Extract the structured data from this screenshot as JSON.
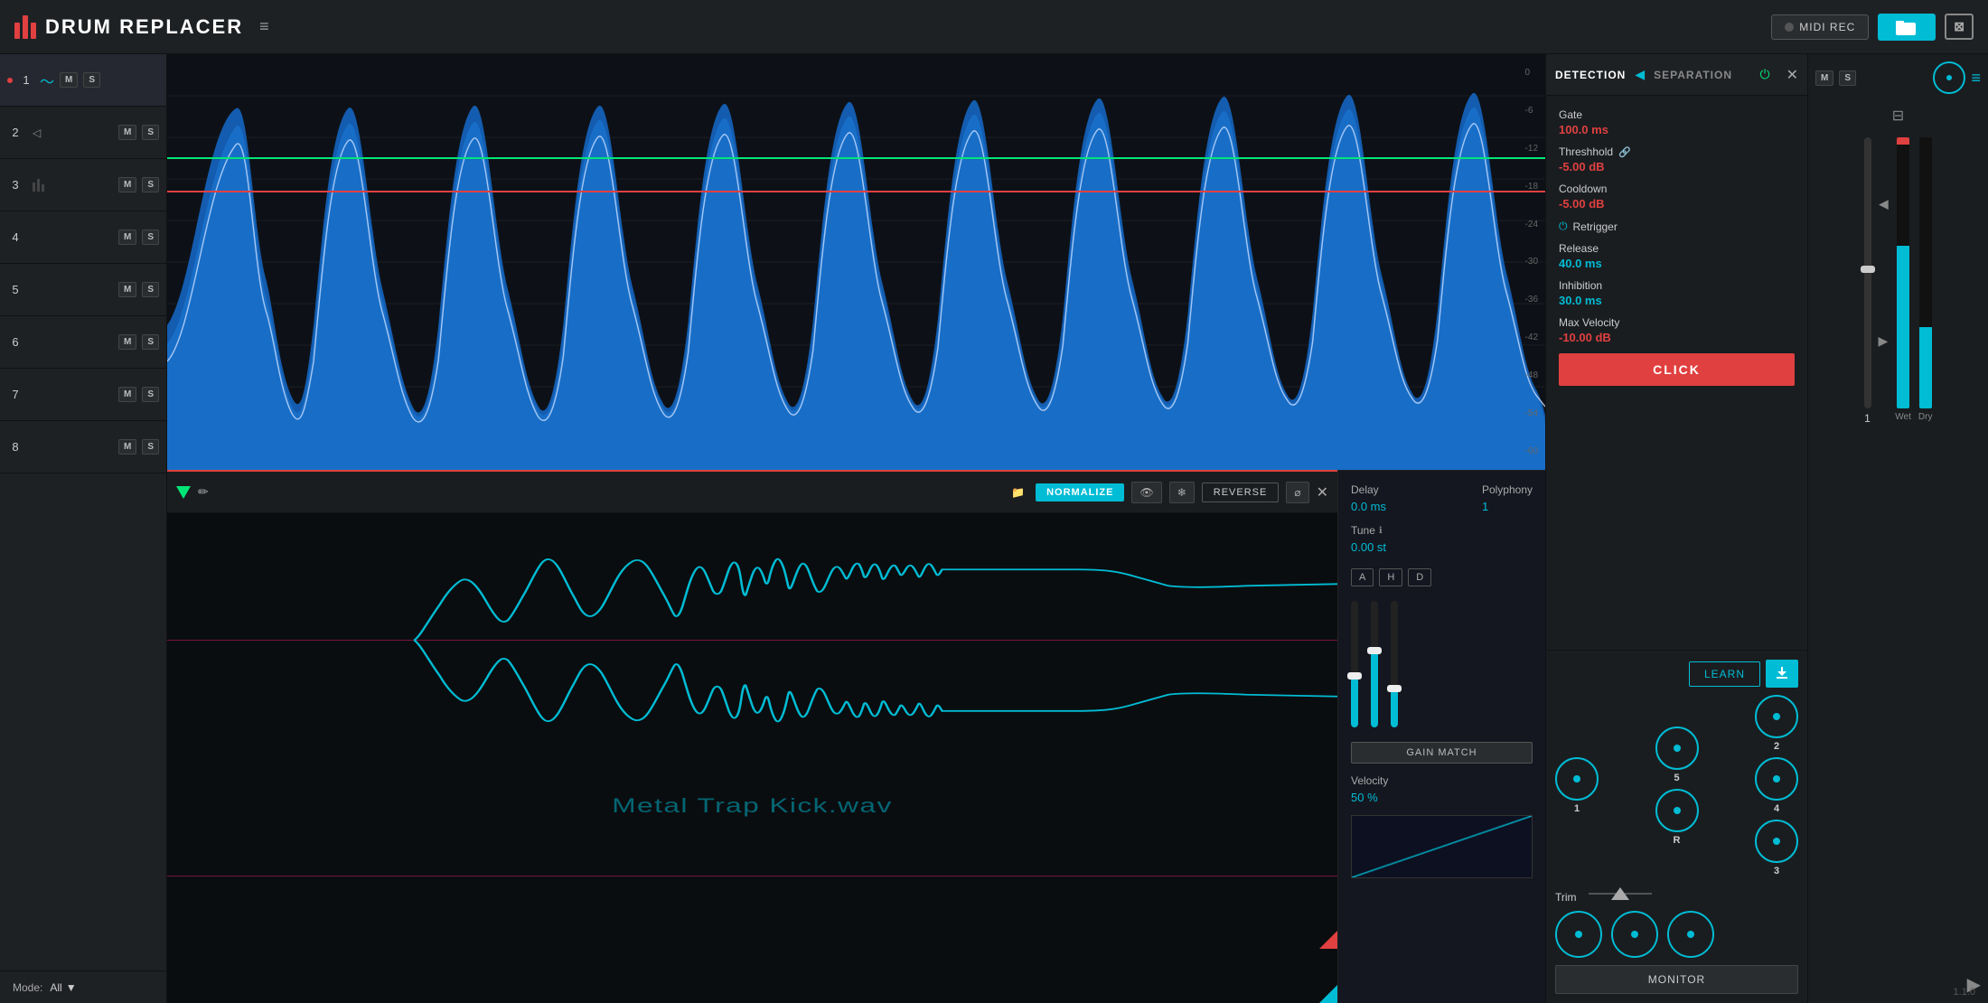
{
  "app": {
    "title": "DRUM REPLACER",
    "version": "1.1.0"
  },
  "header": {
    "midi_rec_label": "MIDI REC",
    "uvi_label": "⊠"
  },
  "detection": {
    "tab1": "DETECTION",
    "tab2": "SEPARATION",
    "gate_label": "Gate",
    "gate_value": "100.0 ms",
    "threshold_label": "Threshhold",
    "threshold_value": "-5.00 dB",
    "cooldown_label": "Cooldown",
    "cooldown_value": "-5.00 dB",
    "retrigger_label": "Retrigger",
    "release_label": "Release",
    "release_value": "40.0 ms",
    "inhibition_label": "Inhibition",
    "inhibition_value": "30.0 ms",
    "max_velocity_label": "Max Velocity",
    "max_velocity_value": "-10.00 dB",
    "click_btn": "CLICK",
    "monitor_btn": "MONITOR",
    "learn_btn": "LEARN",
    "trim_label": "Trim"
  },
  "channel_editor": {
    "channel_name": "Metal Trap Kick",
    "sample_name": "Metal Trap Kick.wav",
    "normalize_btn": "NORMALIZE",
    "reverse_btn": "REVERSE"
  },
  "instrument_params": {
    "delay_label": "Delay",
    "delay_value": "0.0 ms",
    "polyphony_label": "Polyphony",
    "polyphony_value": "1",
    "tune_label": "Tune",
    "tune_value": "0.00 st",
    "gain_match_btn": "GAIN MATCH",
    "velocity_label": "Velocity",
    "velocity_value": "50 %",
    "ahd_a": "A",
    "ahd_h": "H",
    "ahd_d": "D"
  },
  "tracks": [
    {
      "number": "1",
      "type": "active",
      "has_m": true,
      "has_s": true
    },
    {
      "number": "2",
      "type": "normal",
      "has_m": true,
      "has_s": true
    },
    {
      "number": "3",
      "type": "normal",
      "has_m": true,
      "has_s": true
    },
    {
      "number": "4",
      "type": "normal",
      "has_m": true,
      "has_s": true
    },
    {
      "number": "5",
      "type": "normal",
      "has_m": true,
      "has_s": true
    },
    {
      "number": "6",
      "type": "normal",
      "has_m": true,
      "has_s": true
    },
    {
      "number": "7",
      "type": "normal",
      "has_m": true,
      "has_s": true
    },
    {
      "number": "8",
      "type": "normal",
      "has_m": true,
      "has_s": true
    }
  ],
  "db_scale": [
    "0",
    "-6",
    "-12",
    "-18",
    "-24",
    "-30",
    "-36",
    "-42",
    "-48",
    "-54",
    "-60"
  ],
  "knobs": {
    "k1_label": "1",
    "k2_label": "2",
    "k3_label": "3",
    "k4_label": "4",
    "k5_label": "5",
    "kr_label": "R"
  },
  "mode": {
    "label": "Mode:",
    "value": "All"
  },
  "volume": {
    "wet_label": "Wet",
    "dry_label": "Dry"
  }
}
